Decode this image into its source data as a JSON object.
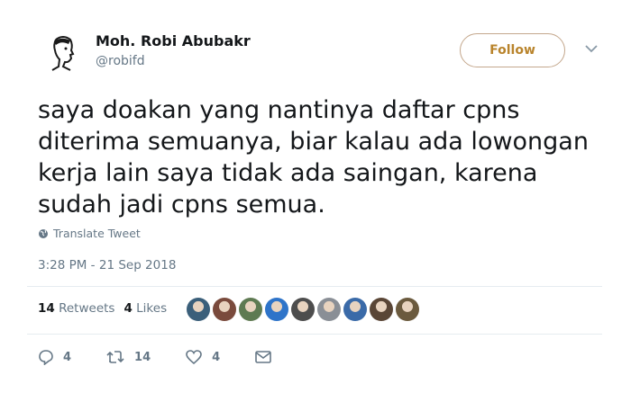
{
  "author": {
    "name": "Moh. Robi Abubakr",
    "handle": "@robifd"
  },
  "follow_label": "Follow",
  "tweet": {
    "text": "saya doakan yang nantinya daftar cpns\nditerima semuanya, biar kalau ada lowongan\nkerja lain saya tidak ada saingan, karena\nsudah jadi cpns semua."
  },
  "translate_label": "Translate Tweet",
  "timestamp": "3:28 PM - 21 Sep 2018",
  "stats": {
    "retweets_count": "14",
    "retweets_label": "Retweets",
    "likes_count": "4",
    "likes_label": "Likes"
  },
  "liker_avatar_colors": [
    "#3b5f7a",
    "#7a4a3c",
    "#5e7a52",
    "#2e74c9",
    "#4d4d4d",
    "#8a8f96",
    "#3a6aa8",
    "#5a4636",
    "#6b5a3e"
  ],
  "actions": {
    "reply_count": "4",
    "retweet_count": "14",
    "like_count": "4"
  },
  "colors": {
    "follow_border": "#c4a78c",
    "follow_text": "#b9842c",
    "secondary_text": "#657786"
  }
}
